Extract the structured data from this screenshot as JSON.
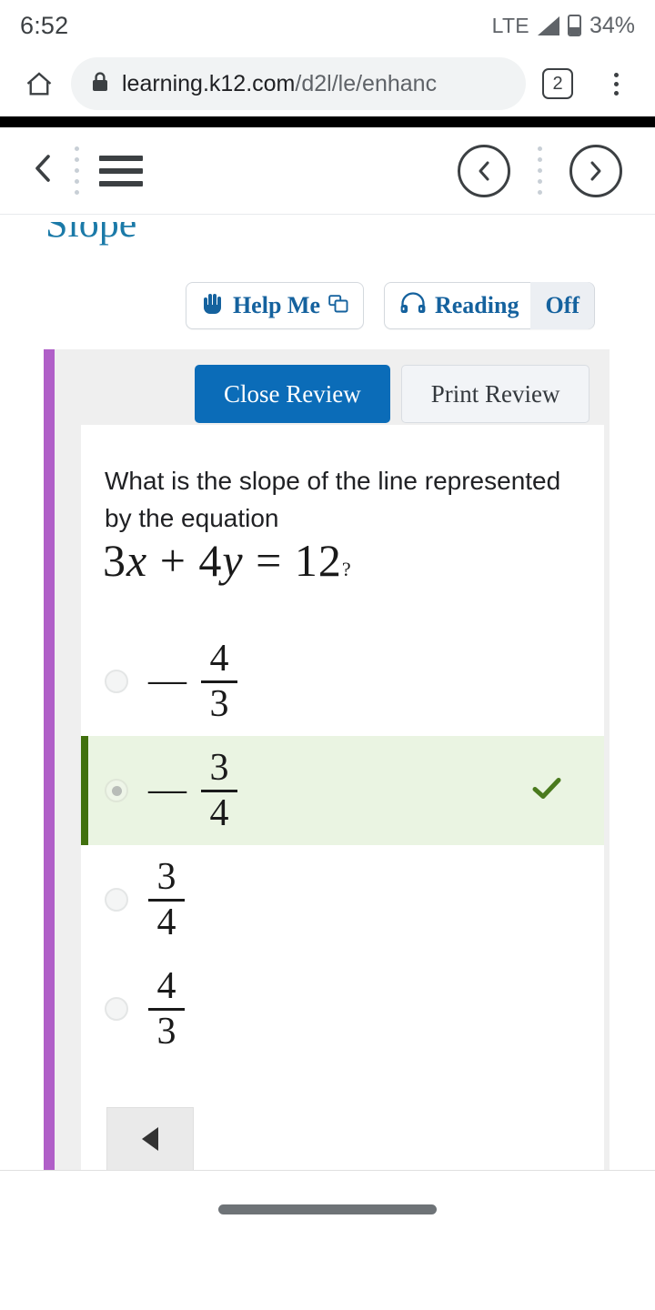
{
  "status_bar": {
    "time": "6:52",
    "network": "LTE",
    "battery_percent": "34%",
    "icons": [
      "signal-triangle-icon",
      "battery-icon"
    ]
  },
  "browser": {
    "home_icon": "home-icon",
    "lock_icon": "lock-icon",
    "url_host": "learning.k12.com",
    "url_path": "/d2l/le/enhanc",
    "tab_count": "2",
    "menu_icon": "kebab-menu-icon"
  },
  "app_toolbar": {
    "back_icon": "chevron-left-icon",
    "menu_icon": "hamburger-menu-icon",
    "prev_icon": "circle-chevron-left-icon",
    "next_icon": "circle-chevron-right-icon",
    "divider_icon": "dotted-divider-icon"
  },
  "lesson": {
    "title": "Slope",
    "title_color": "#1b7aa8"
  },
  "tools": {
    "help_label": "Help Me",
    "help_icon": "raised-hand-icon",
    "popout_icon": "external-window-icon",
    "reading_label": "Reading",
    "reading_state": "Off",
    "headphones_icon": "headphones-icon"
  },
  "review": {
    "close_label": "Close Review",
    "print_label": "Print Review",
    "close_color": "#0b6cb8"
  },
  "question": {
    "prompt": "What is the slope of the line represented by the equation",
    "equation": "3x + 4y = 12",
    "equation_parts": {
      "a": "3",
      "x": "x",
      "plus": "+",
      "b": "4",
      "y": "y",
      "equals": "=",
      "c": "12"
    },
    "question_mark": "?"
  },
  "options": [
    {
      "sign": "—",
      "numerator": "4",
      "denominator": "3",
      "selected": false,
      "correct": false
    },
    {
      "sign": "—",
      "numerator": "3",
      "denominator": "4",
      "selected": true,
      "correct": true
    },
    {
      "sign": "",
      "numerator": "3",
      "denominator": "4",
      "selected": false,
      "correct": false
    },
    {
      "sign": "",
      "numerator": "4",
      "denominator": "3",
      "selected": false,
      "correct": false
    }
  ],
  "feedback": {
    "check_icon": "check-mark-icon",
    "correct_bg": "#eaf4e2",
    "correct_border": "#41700e",
    "check_color": "#4a7a1e"
  },
  "footer": {
    "prev_icon": "triangle-left-icon"
  },
  "accent": {
    "rail_purple": "#b05fc8",
    "link_blue": "#15629e"
  },
  "system_nav": {
    "gesture_icon": "gesture-pill-icon"
  }
}
